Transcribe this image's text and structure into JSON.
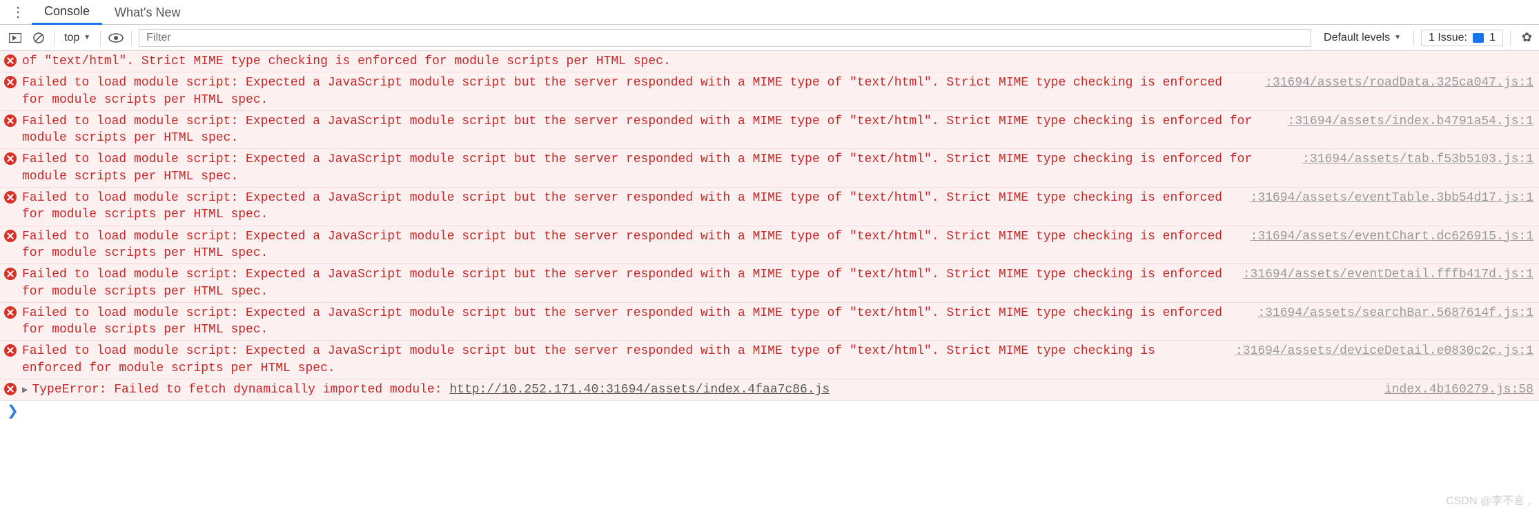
{
  "tabs": {
    "console": "Console",
    "whatsnew": "What's New"
  },
  "toolbar": {
    "context": "top",
    "filter_placeholder": "Filter",
    "levels": "Default levels",
    "issue_label": "1 Issue:",
    "issue_count": "1"
  },
  "partial_first": {
    "msg": "of \"text/html\". Strict MIME type checking is enforced for module scripts per HTML spec."
  },
  "errors": [
    {
      "msg": "Failed to load module script: Expected a JavaScript module script but the server responded with a MIME type of \"text/html\". Strict MIME type checking is enforced for module scripts per HTML spec.",
      "src": ":31694/assets/roadData.325ca047.js:1"
    },
    {
      "msg": "Failed to load module script: Expected a JavaScript module script but the server responded with a MIME type of \"text/html\". Strict MIME type checking is enforced for module scripts per HTML spec.",
      "src": ":31694/assets/index.b4791a54.js:1"
    },
    {
      "msg": "Failed to load module script: Expected a JavaScript module script but the server responded with a MIME type of \"text/html\". Strict MIME type checking is enforced for module scripts per HTML spec.",
      "src": ":31694/assets/tab.f53b5103.js:1"
    },
    {
      "msg": "Failed to load module script: Expected a JavaScript module script but the server responded with a MIME type of \"text/html\". Strict MIME type checking is enforced for module scripts per HTML spec.",
      "src": ":31694/assets/eventTable.3bb54d17.js:1"
    },
    {
      "msg": "Failed to load module script: Expected a JavaScript module script but the server responded with a MIME type of \"text/html\". Strict MIME type checking is enforced for module scripts per HTML spec.",
      "src": ":31694/assets/eventChart.dc626915.js:1"
    },
    {
      "msg": "Failed to load module script: Expected a JavaScript module script but the server responded with a MIME type of \"text/html\". Strict MIME type checking is enforced for module scripts per HTML spec.",
      "src": ":31694/assets/eventDetail.fffb417d.js:1"
    },
    {
      "msg": "Failed to load module script: Expected a JavaScript module script but the server responded with a MIME type of \"text/html\". Strict MIME type checking is enforced for module scripts per HTML spec.",
      "src": ":31694/assets/searchBar.5687614f.js:1"
    },
    {
      "msg": "Failed to load module script: Expected a JavaScript module script but the server responded with a MIME type of \"text/html\". Strict MIME type checking is enforced for module scripts per HTML spec.",
      "src": ":31694/assets/deviceDetail.e0830c2c.js:1"
    }
  ],
  "typeerror": {
    "prefix": "TypeError: Failed to fetch dynamically imported module: ",
    "link": "http://10.252.171.40:31694/assets/index.4faa7c86.js",
    "src": "index.4b160279.js:58"
  },
  "prompt": "❯",
  "watermark": "CSDN @李不言 ,"
}
